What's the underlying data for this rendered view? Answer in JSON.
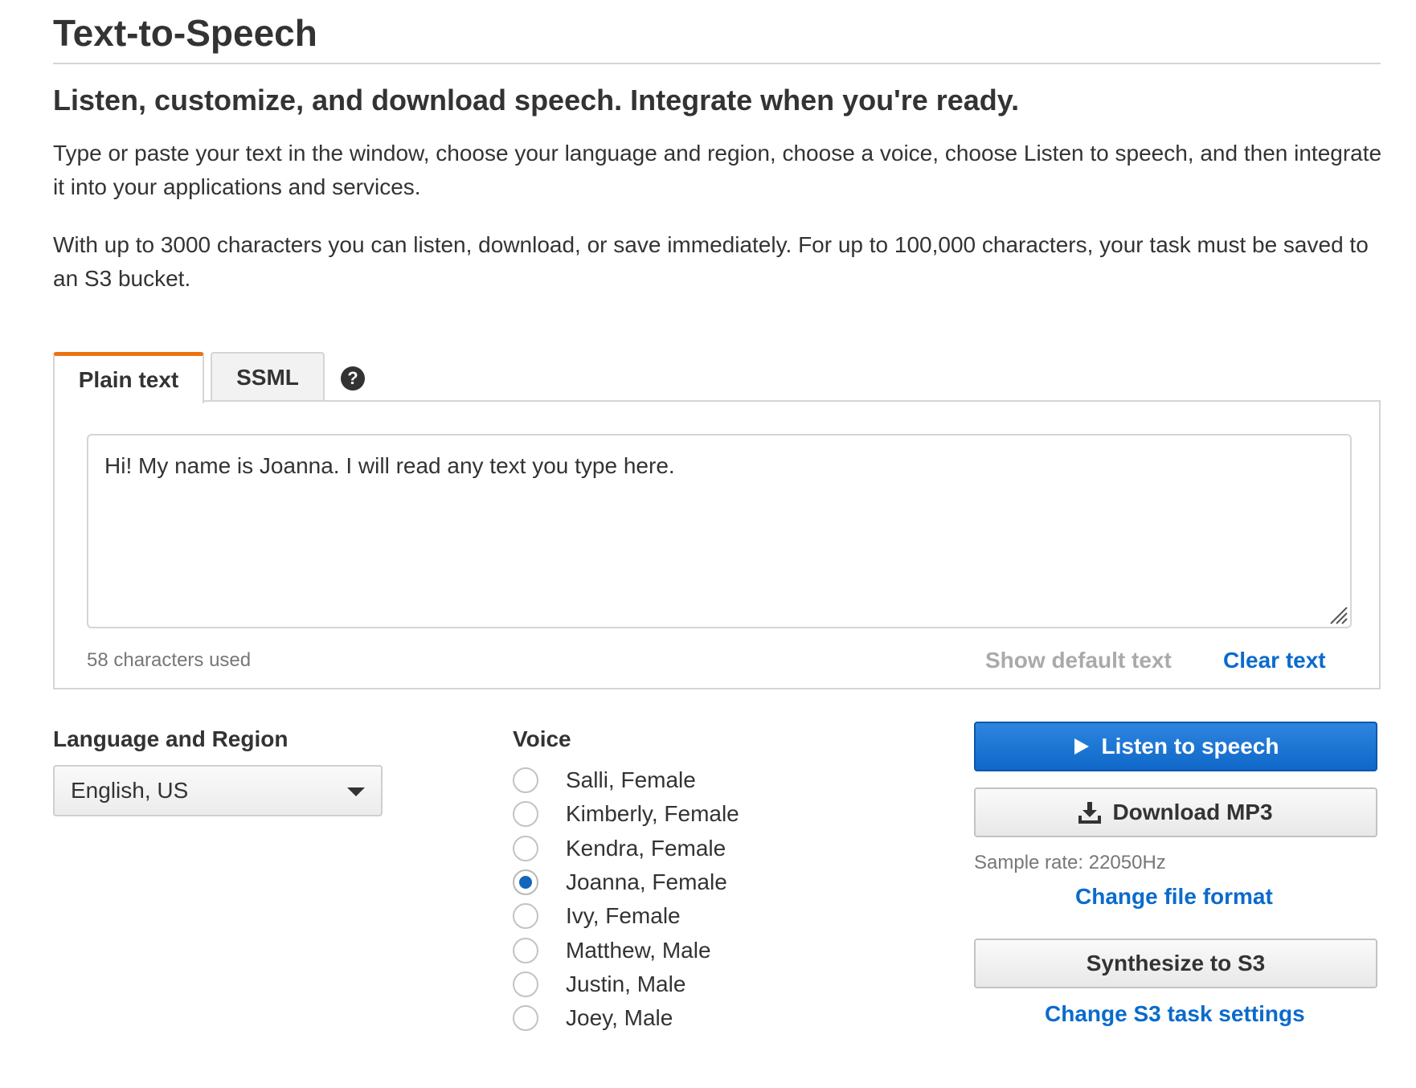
{
  "page": {
    "title": "Text-to-Speech",
    "subtitle": "Listen, customize, and download speech. Integrate when you're ready.",
    "description_1": "Type or paste your text in the window, choose your language and region, choose a voice, choose Listen to speech, and then integrate it into your applications and services.",
    "description_2": "With up to 3000 characters you can listen, download, or save immediately. For up to 100,000 characters, your task must be saved to an S3 bucket."
  },
  "tabs": [
    {
      "label": "Plain text",
      "active": true
    },
    {
      "label": "SSML",
      "active": false
    }
  ],
  "help_icon": "question-circle-icon",
  "editor": {
    "text": "Hi! My name is Joanna. I will read any text you type here.",
    "char_count": "58 characters used",
    "show_default_label": "Show default text",
    "clear_label": "Clear text"
  },
  "language": {
    "label": "Language and Region",
    "selected": "English, US"
  },
  "voice": {
    "label": "Voice",
    "options": [
      {
        "name": "Salli, Female",
        "selected": false
      },
      {
        "name": "Kimberly, Female",
        "selected": false
      },
      {
        "name": "Kendra, Female",
        "selected": false
      },
      {
        "name": "Joanna, Female",
        "selected": true
      },
      {
        "name": "Ivy, Female",
        "selected": false
      },
      {
        "name": "Matthew, Male",
        "selected": false
      },
      {
        "name": "Justin, Male",
        "selected": false
      },
      {
        "name": "Joey, Male",
        "selected": false
      }
    ]
  },
  "actions": {
    "listen_label": "Listen to speech",
    "download_label": "Download MP3",
    "sample_rate": "Sample rate: 22050Hz",
    "change_format_label": "Change file format",
    "synthesize_label": "Synthesize to S3",
    "change_s3_label": "Change S3 task settings"
  },
  "colors": {
    "accent_tab": "#ec7211",
    "primary_button": "#1a73d4",
    "link": "#0a6bcd"
  }
}
